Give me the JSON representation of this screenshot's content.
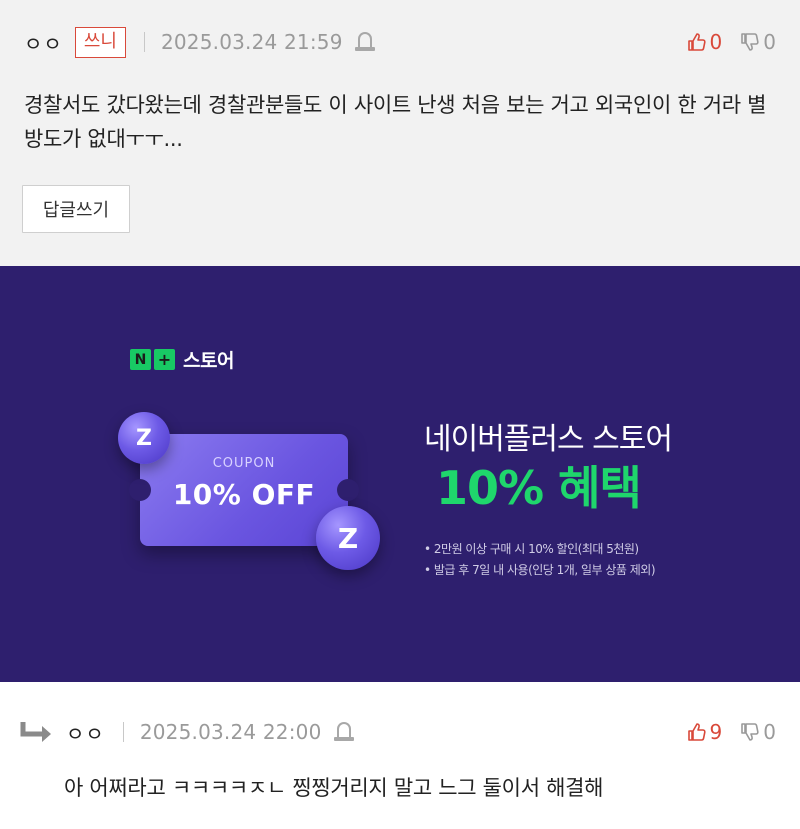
{
  "comment_1": {
    "nickname": "ㅇㅇ",
    "badge": "쓰니",
    "timestamp": "2025.03.24 21:59",
    "upvotes": "0",
    "downvotes": "0",
    "text": "경찰서도 갔다왔는데 경찰관분들도 이 사이트 난생 처음 보는 거고 외국인이 한 거라 별 방도가 없대ㅜㅜ...",
    "reply_button": "답글쓰기"
  },
  "ad": {
    "logo_n": "N",
    "logo_plus": "+",
    "logo_text": "스토어",
    "coupon_label": "COUPON",
    "coupon_value": "10% OFF",
    "title": "네이버플러스 스토어",
    "benefit": "10% 혜택",
    "notes": [
      "• 2만원 이상 구매 시 10% 할인(최대 5천원)",
      "• 발급 후 7일 내 사용(인당 1개, 일부 상품 제외)"
    ],
    "colors": {
      "background": "#2e1f6e",
      "accent_green": "#1fd66c",
      "coupon": "#6a55e0"
    }
  },
  "comment_2": {
    "nickname": "ㅇㅇ",
    "timestamp": "2025.03.24 22:00",
    "upvotes": "9",
    "downvotes": "0",
    "text": "아 어쩌라고 ㅋㅋㅋㅋㅈㄴ 찡찡거리지 말고 느그 둘이서 해결해"
  },
  "icons": {
    "report": "siren-report-icon",
    "upvote": "thumbs-up-icon",
    "downvote": "thumbs-down-icon",
    "reply": "reply-arrow-icon"
  },
  "colors": {
    "upvote": "#d9493a",
    "muted": "#9a9a9a",
    "comment_bg": "#f2f2f2"
  }
}
